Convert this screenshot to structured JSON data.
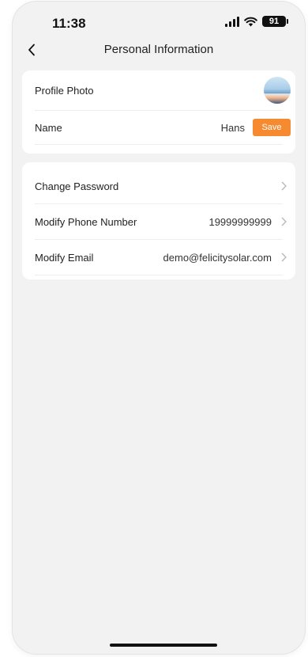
{
  "status_bar": {
    "time": "11:38",
    "battery": "91"
  },
  "header": {
    "title": "Personal Information"
  },
  "profile_card": {
    "photo_label": "Profile Photo",
    "name_label": "Name",
    "name_value": "Hans",
    "save_label": "Save"
  },
  "account_card": {
    "items": [
      {
        "label": "Change Password",
        "value": ""
      },
      {
        "label": "Modify Phone Number",
        "value": "19999999999"
      },
      {
        "label": "Modify Email",
        "value": "demo@felicitysolar.com"
      }
    ]
  },
  "colors": {
    "accent": "#f58a30",
    "background": "#f2f2f2",
    "card": "#ffffff"
  }
}
